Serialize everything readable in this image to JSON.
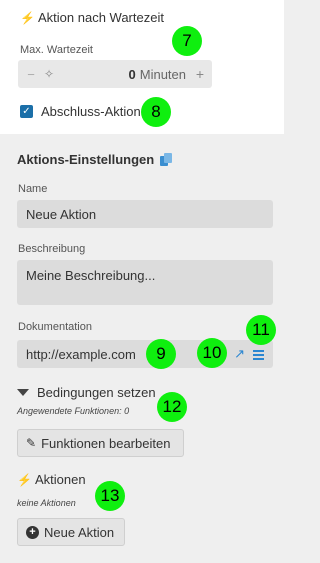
{
  "wait_section": {
    "title": "Aktion nach Wartezeit",
    "title_icon": "bolt-icon",
    "max_wait_label": "Max. Wartezeit",
    "stepper": {
      "minus": "−",
      "value": "0",
      "unit": "Minuten",
      "plus": "+"
    },
    "marker": "7"
  },
  "final_action": {
    "label": "Abschluss-Aktion",
    "checked": true,
    "marker": "8"
  },
  "settings": {
    "title": "Aktions-Einstellungen",
    "name_label": "Name",
    "name_value": "Neue Aktion",
    "description_label": "Beschreibung",
    "description_value": "Meine Beschreibung...",
    "documentation_label": "Dokumentation",
    "documentation_value": "http://example.com",
    "markers": {
      "doc_field": "9",
      "external_link": "10",
      "menu": "11"
    }
  },
  "conditions": {
    "title": "Bedingungen setzen",
    "applied_text": "Angewendete Funktionen: 0",
    "edit_button": "Funktionen bearbeiten",
    "marker": "12"
  },
  "actions": {
    "title": "Aktionen",
    "empty_text": "keine Aktionen",
    "new_button": "Neue Aktion",
    "marker": "13"
  },
  "colors": {
    "marker": "#0fef0f",
    "accent": "#2a86d1",
    "checkbox": "#1b6fa8",
    "panel": "#efefef"
  }
}
